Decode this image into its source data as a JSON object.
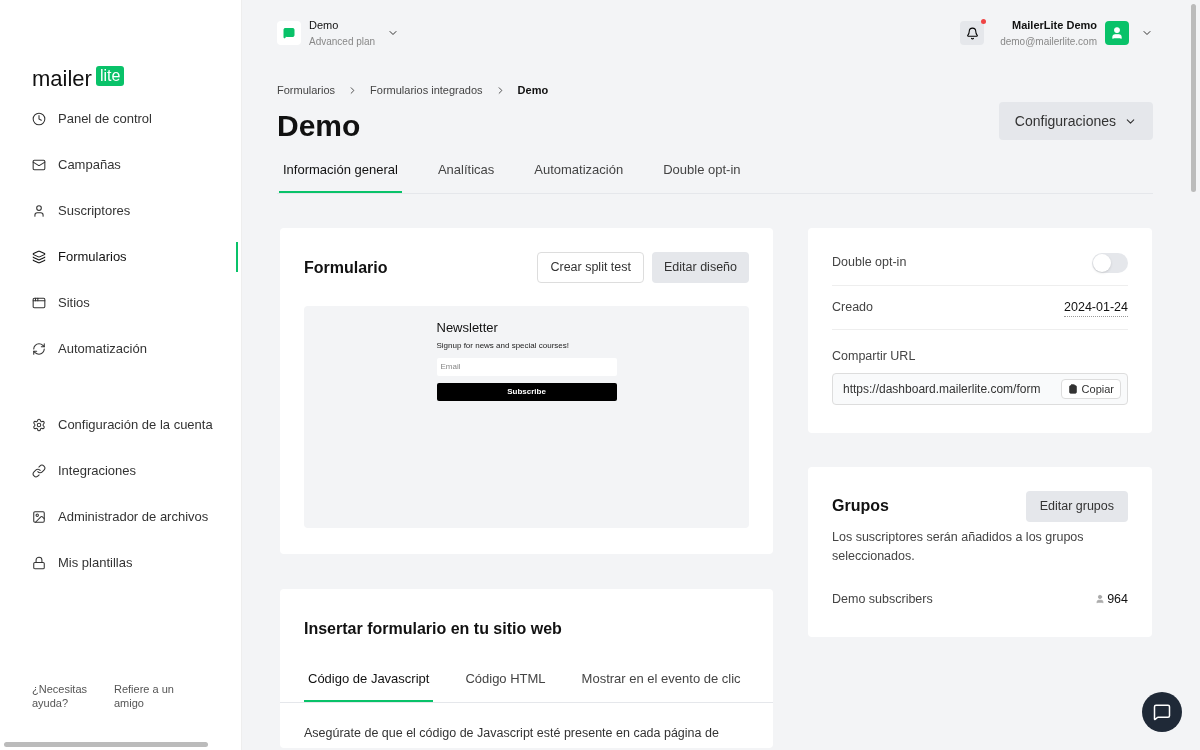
{
  "sidebar": {
    "logo": {
      "word": "mailer",
      "badge": "lite"
    },
    "items": [
      {
        "label": "Panel de control",
        "selected": false
      },
      {
        "label": "Campañas",
        "selected": false
      },
      {
        "label": "Suscriptores",
        "selected": false
      },
      {
        "label": "Formularios",
        "selected": true
      },
      {
        "label": "Sitios",
        "selected": false
      },
      {
        "label": "Automatización",
        "selected": false
      }
    ],
    "settings_items": [
      {
        "label": "Configuración de la cuenta"
      },
      {
        "label": "Integraciones"
      },
      {
        "label": "Administrador de archivos"
      },
      {
        "label": "Mis plantillas"
      }
    ],
    "footer": [
      "¿Necesitas ayuda?",
      "Refiere a un amigo"
    ]
  },
  "header": {
    "account": {
      "name": "Demo",
      "plan": "Advanced plan"
    },
    "notifications": {
      "unread": true
    },
    "user": {
      "name": "MailerLite Demo",
      "email": "demo@mailerlite.com"
    }
  },
  "breadcrumbs": [
    "Formularios",
    "Formularios integrados",
    "Demo"
  ],
  "page_title": "Demo",
  "settings_button": "Configuraciones",
  "tabs": [
    {
      "label": "Información general",
      "selected": true
    },
    {
      "label": "Analíticas",
      "selected": false
    },
    {
      "label": "Automatización",
      "selected": false
    },
    {
      "label": "Double opt-in",
      "selected": false
    }
  ],
  "form_card": {
    "title": "Formulario",
    "buttons": [
      "Crear split test",
      "Editar diseño"
    ],
    "preview": {
      "title": "Newsletter",
      "subtitle": "Signup for news and special courses!",
      "placeholder": "Email",
      "button": "Subscribe"
    }
  },
  "details_card": {
    "double_opt_in": {
      "label": "Double opt-in",
      "on": false
    },
    "created": {
      "label": "Creado",
      "value": "2024-01-24"
    },
    "share": {
      "label": "Compartir URL",
      "value": "https://dashboard.mailerlite.com/form",
      "copy": "Copiar"
    }
  },
  "groups_card": {
    "title": "Grupos",
    "button": "Editar grupos",
    "description": "Los suscriptores serán añadidos a los grupos seleccionados.",
    "groups": [
      {
        "name": "Demo subscribers",
        "count": "964"
      }
    ]
  },
  "embed_card": {
    "title": "Insertar formulario en tu sitio web",
    "tabs": [
      {
        "label": "Código de Javascript",
        "selected": true
      },
      {
        "label": "Código HTML",
        "selected": false
      },
      {
        "label": "Mostrar en el evento de clic",
        "selected": false
      }
    ],
    "text": "Asegúrate de que el código de Javascript esté presente en cada página de"
  }
}
